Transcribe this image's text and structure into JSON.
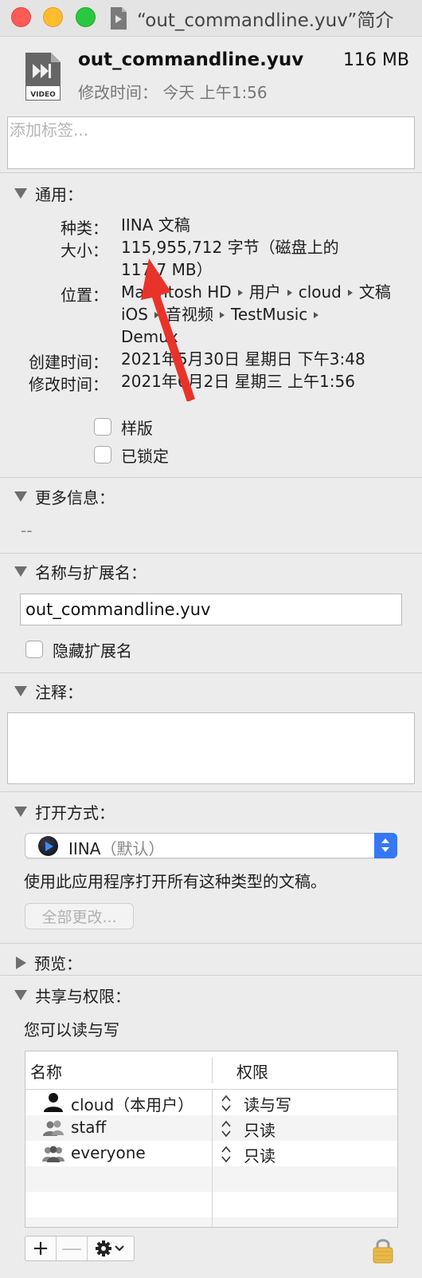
{
  "window": {
    "title": "“out_commandline.yuv”简介"
  },
  "header": {
    "icon_label": "VIDEO",
    "file_name": "out_commandline.yuv",
    "size": "116 MB",
    "modified": "修改时间： 今天 上午1:56"
  },
  "tags": {
    "placeholder": "添加标签..."
  },
  "general": {
    "heading": "通用：",
    "kind_label": "种类：",
    "kind_value": "IINA 文稿",
    "size_label": "大小：",
    "size_value_line1": "115,955,712 字节（磁盘上的",
    "size_value_line2": "117.7 MB）",
    "where_label": "位置：",
    "path": [
      "Macintosh HD",
      "用户",
      "cloud",
      "文稿",
      "iOS",
      "音视频",
      "TestMusic",
      "Demux"
    ],
    "created_label": "创建时间：",
    "created_value": "2021年5月30日 星期日 下午3:48",
    "modified_label": "修改时间：",
    "modified_value": "2021年6月2日 星期三 上午1:56",
    "stationery_label": "样版",
    "locked_label": "已锁定"
  },
  "more_info": {
    "heading": "更多信息：",
    "value": "--"
  },
  "name_ext": {
    "heading": "名称与扩展名：",
    "value": "out_commandline.yuv",
    "hide_ext_label": "隐藏扩展名"
  },
  "comments": {
    "heading": "注释："
  },
  "open_with": {
    "heading": "打开方式：",
    "app": "IINA",
    "default_suffix": "（默认）",
    "description": "使用此应用程序打开所有这种类型的文稿。",
    "change_all_label": "全部更改..."
  },
  "preview": {
    "heading": "预览："
  },
  "sharing": {
    "heading": "共享与权限：",
    "description": "您可以读与写",
    "col_name": "名称",
    "col_privilege": "权限",
    "rows": [
      {
        "name": "cloud（本用户）",
        "privilege": "读与写",
        "icon": "user-icon"
      },
      {
        "name": "staff",
        "privilege": "只读",
        "icon": "group-icon"
      },
      {
        "name": "everyone",
        "privilege": "只读",
        "icon": "everyone-icon"
      }
    ],
    "add_label": "+",
    "remove_label": "—"
  },
  "colors": {
    "accent": "#3478f6",
    "annotation_arrow": "#e8332a"
  }
}
